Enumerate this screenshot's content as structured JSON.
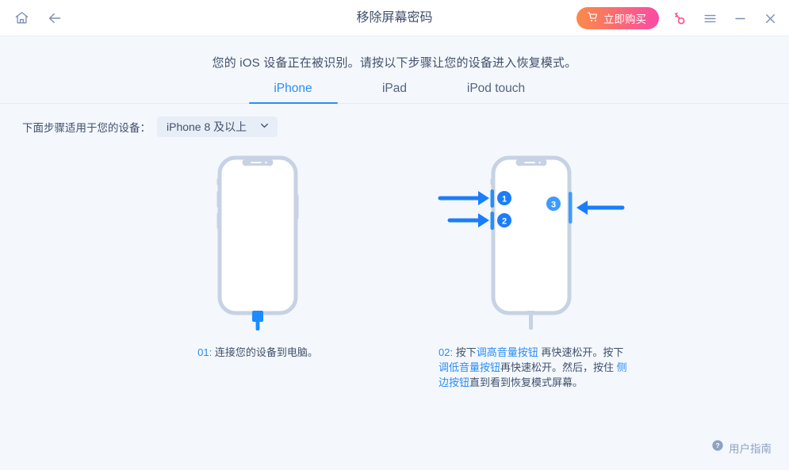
{
  "titlebar": {
    "home_icon": "home-icon",
    "back_icon": "back-arrow-icon",
    "title": "移除屏幕密码",
    "buy_label": "立即购买",
    "cart_icon": "shopping-cart-icon",
    "key_icon": "key-icon",
    "menu_icon": "hamburger-menu-icon",
    "minimize_icon": "minimize-icon",
    "close_icon": "close-icon"
  },
  "main": {
    "headline": "您的 iOS 设备正在被识别。请按以下步骤让您的设备进入恢复模式。",
    "tabs": [
      {
        "label": "iPhone",
        "active": true
      },
      {
        "label": "iPad",
        "active": false
      },
      {
        "label": "iPod touch",
        "active": false
      }
    ],
    "device_row": {
      "label": "下面步骤适用于您的设备：",
      "selected": "iPhone 8 及以上",
      "chevron_icon": "chevron-down-icon"
    },
    "steps": [
      {
        "number": "01:",
        "text": "连接您的设备到电脑。",
        "illustration": "iphone-with-cable"
      },
      {
        "number": "02:",
        "illustration": "iphone-with-button-callouts",
        "callouts": [
          "1",
          "2",
          "3"
        ],
        "parts": [
          {
            "text": "按下",
            "highlight": false
          },
          {
            "text": "调高音量按钮",
            "highlight": true
          },
          {
            "text": " 再快速松开。按下",
            "highlight": false
          },
          {
            "text": "调低音量按钮",
            "highlight": true
          },
          {
            "text": "再快速松开。然后，按住 ",
            "highlight": false
          },
          {
            "text": "侧边按钮",
            "highlight": true
          },
          {
            "text": "直到看到恢复模式屏幕。",
            "highlight": false
          }
        ]
      }
    ]
  },
  "footer": {
    "help_icon": "question-circle-icon",
    "label": "用户指南"
  },
  "colors": {
    "accent_blue": "#2a8cf7",
    "background": "#f4f8fd",
    "titlebar": "#ffffff",
    "text_dark": "#41506b",
    "muted": "#8fa2c4",
    "device_outline": "#c7d2e4",
    "buy_gradient_start": "#fb8b4a",
    "buy_gradient_end": "#fb4ba6"
  }
}
